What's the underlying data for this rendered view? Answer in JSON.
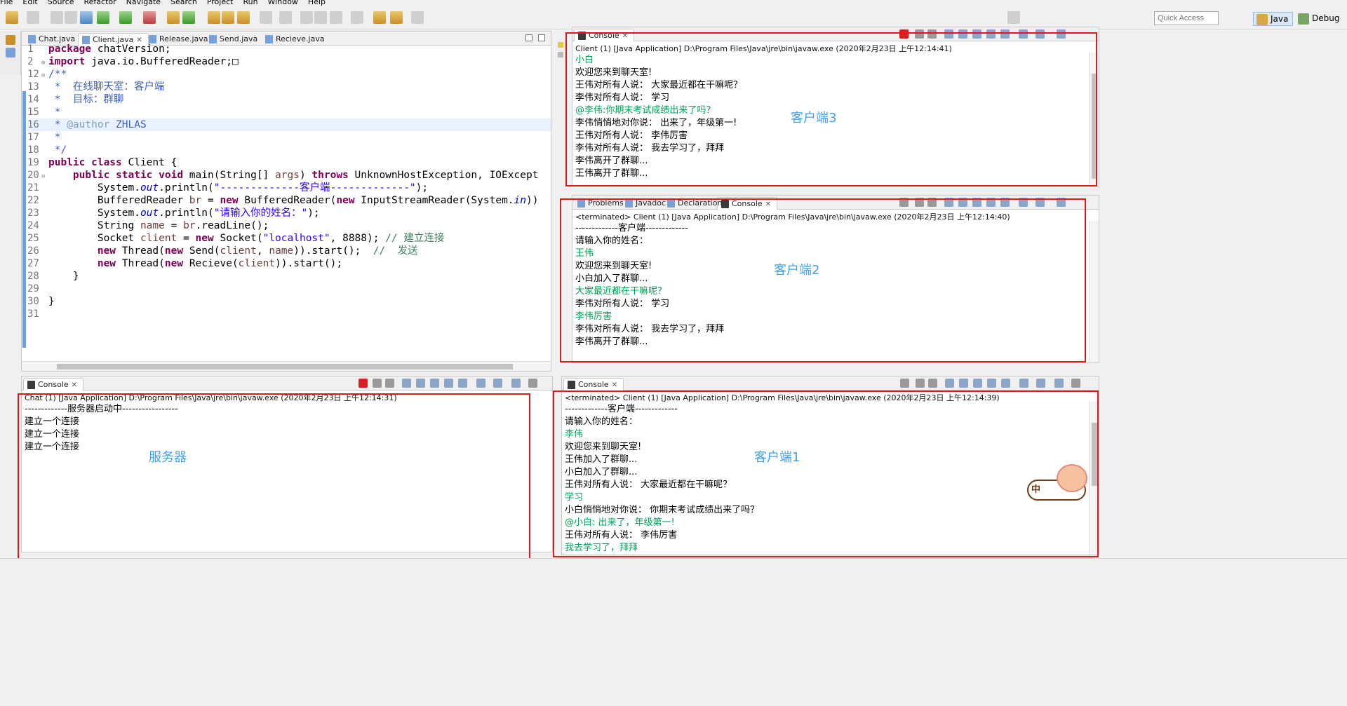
{
  "menu": [
    "File",
    "Edit",
    "Source",
    "Refactor",
    "Navigate",
    "Search",
    "Project",
    "Run",
    "Window",
    "Help"
  ],
  "toolbar": {
    "quick_access_placeholder": "Quick Access",
    "perspective_java": "Java",
    "perspective_debug": "Debug"
  },
  "editor": {
    "tabs": [
      {
        "label": "Chat.java",
        "active": false
      },
      {
        "label": "Client.java",
        "active": true
      },
      {
        "label": "Release.java",
        "active": false
      },
      {
        "label": "Send.java",
        "active": false
      },
      {
        "label": "Recieve.java",
        "active": false
      }
    ],
    "lines": [
      {
        "n": "1",
        "fold": "",
        "html": "<span class='kw'>package</span> chatVersion;"
      },
      {
        "n": "2",
        "fold": "⊕",
        "html": "<span class='kw'>import</span> java.io.BufferedReader;□"
      },
      {
        "n": "12",
        "fold": "⊖",
        "html": "<span class='jd'>/**</span>"
      },
      {
        "n": "13",
        "fold": "",
        "html": "<span class='jd'> *  在线聊天室：客户端</span>"
      },
      {
        "n": "14",
        "fold": "",
        "html": "<span class='jd'> *  目标：群聊</span>"
      },
      {
        "n": "15",
        "fold": "",
        "html": "<span class='jd'> *</span>"
      },
      {
        "n": "16",
        "fold": "",
        "hl": true,
        "html": "<span class='jd'> * </span><span class='jdtag'>@author</span><span class='jd'> ZHLAS</span>"
      },
      {
        "n": "17",
        "fold": "",
        "html": "<span class='jd'> *</span>"
      },
      {
        "n": "18",
        "fold": "",
        "html": "<span class='jd'> */</span>"
      },
      {
        "n": "19",
        "fold": "",
        "html": "<span class='kw'>public class</span> Client {"
      },
      {
        "n": "20",
        "fold": "⊖",
        "html": "    <span class='kw'>public static void</span> main(String[] <span class='var'>args</span>) <span class='kw'>throws</span> UnknownHostException, IOExcept"
      },
      {
        "n": "21",
        "fold": "",
        "html": "        System.<span class='fld'>out</span>.println(<span class='str'>\"-------------客户端-------------\"</span>);"
      },
      {
        "n": "22",
        "fold": "",
        "html": "        BufferedReader <span class='var'>br</span> = <span class='kw'>new</span> BufferedReader(<span class='kw'>new</span> InputStreamReader(System.<span class='fld'>in</span>))"
      },
      {
        "n": "23",
        "fold": "",
        "html": "        System.<span class='fld'>out</span>.println(<span class='str'>\"请输入你的姓名：\"</span>);"
      },
      {
        "n": "24",
        "fold": "",
        "html": "        String <span class='var'>name</span> = <span class='var'>br</span>.readLine();"
      },
      {
        "n": "25",
        "fold": "",
        "html": "        Socket <span class='var'>client</span> = <span class='kw'>new</span> Socket(<span class='str'>\"localhost\"</span>, 8888); <span class='cm'>// 建立连接</span>"
      },
      {
        "n": "26",
        "fold": "",
        "html": "        <span class='kw'>new</span> Thread(<span class='kw'>new</span> Send(<span class='var'>client</span>, <span class='var'>name</span>)).start();  <span class='cm'>//  发送</span>"
      },
      {
        "n": "27",
        "fold": "",
        "html": "        <span class='kw'>new</span> Thread(<span class='kw'>new</span> Recieve(<span class='var'>client</span>)).start();"
      },
      {
        "n": "28",
        "fold": "",
        "html": "    }"
      },
      {
        "n": "29",
        "fold": "",
        "html": ""
      },
      {
        "n": "30",
        "fold": "",
        "html": "}"
      },
      {
        "n": "31",
        "fold": "",
        "html": ""
      }
    ]
  },
  "console3": {
    "tab": "Console",
    "header": "Client (1) [Java Application] D:\\Program Files\\Java\\jre\\bin\\javaw.exe (2020年2月23日 上午12:14:41)",
    "lines": [
      {
        "t": "小白",
        "in": true
      },
      {
        "t": "欢迎您来到聊天室!",
        "in": false
      },
      {
        "t": "王伟对所有人说： 大家最近都在干嘛呢？",
        "in": false
      },
      {
        "t": "李伟对所有人说： 学习",
        "in": false
      },
      {
        "t": "@李伟:你期末考试成绩出来了吗？",
        "in": true
      },
      {
        "t": "李伟悄悄地对你说： 出来了，年级第一!",
        "in": false
      },
      {
        "t": "王伟对所有人说： 李伟厉害",
        "in": false
      },
      {
        "t": "李伟对所有人说： 我去学习了，拜拜",
        "in": false
      },
      {
        "t": "李伟离开了群聊...",
        "in": false
      },
      {
        "t": "王伟离开了群聊...",
        "in": false
      }
    ],
    "annotation": "客户端3"
  },
  "console2": {
    "tabs": [
      "Problems",
      "Javadoc",
      "Declaration",
      "Console"
    ],
    "header": "<terminated> Client (1) [Java Application] D:\\Program Files\\Java\\jre\\bin\\javaw.exe (2020年2月23日 上午12:14:40)",
    "lines": [
      {
        "t": "-------------客户端-------------",
        "in": false
      },
      {
        "t": "请输入你的姓名：",
        "in": false
      },
      {
        "t": "王伟",
        "in": true
      },
      {
        "t": "欢迎您来到聊天室!",
        "in": false
      },
      {
        "t": "小白加入了群聊...",
        "in": false
      },
      {
        "t": "大家最近都在干嘛呢？",
        "in": true
      },
      {
        "t": "李伟对所有人说： 学习",
        "in": false
      },
      {
        "t": "李伟厉害",
        "in": true
      },
      {
        "t": "李伟对所有人说： 我去学习了，拜拜",
        "in": false
      },
      {
        "t": "李伟离开了群聊...",
        "in": false
      }
    ],
    "annotation": "客户端2"
  },
  "console_server": {
    "tab": "Console",
    "header": "Chat (1) [Java Application] D:\\Program Files\\Java\\jre\\bin\\javaw.exe (2020年2月23日 上午12:14:31)",
    "lines": [
      {
        "t": "-------------服务器启动中-----------------",
        "in": false
      },
      {
        "t": "建立一个连接",
        "in": false
      },
      {
        "t": "建立一个连接",
        "in": false
      },
      {
        "t": "建立一个连接",
        "in": false
      }
    ],
    "annotation": "服务器"
  },
  "console1": {
    "tab": "Console",
    "header": "<terminated> Client (1) [Java Application] D:\\Program Files\\Java\\jre\\bin\\javaw.exe (2020年2月23日 上午12:14:39)",
    "lines": [
      {
        "t": "-------------客户端-------------",
        "in": false
      },
      {
        "t": "请输入你的姓名：",
        "in": false
      },
      {
        "t": "李伟",
        "in": true
      },
      {
        "t": "欢迎您来到聊天室!",
        "in": false
      },
      {
        "t": "王伟加入了群聊...",
        "in": false
      },
      {
        "t": "小白加入了群聊...",
        "in": false
      },
      {
        "t": "王伟对所有人说： 大家最近都在干嘛呢？",
        "in": false
      },
      {
        "t": "学习",
        "in": true
      },
      {
        "t": "小白悄悄地对你说： 你期末考试成绩出来了吗？",
        "in": false
      },
      {
        "t": "@小白: 出来了，年级第一!",
        "in": true
      },
      {
        "t": "王伟对所有人说： 李伟厉害",
        "in": false
      },
      {
        "t": "我去学习了，拜拜",
        "in": true
      }
    ],
    "annotation": "客户端1"
  },
  "mascot_char": "中",
  "colors": {
    "input_text": "#00a05a",
    "annotation": "#3fa1ef",
    "highlight_box": "#e0191c"
  }
}
